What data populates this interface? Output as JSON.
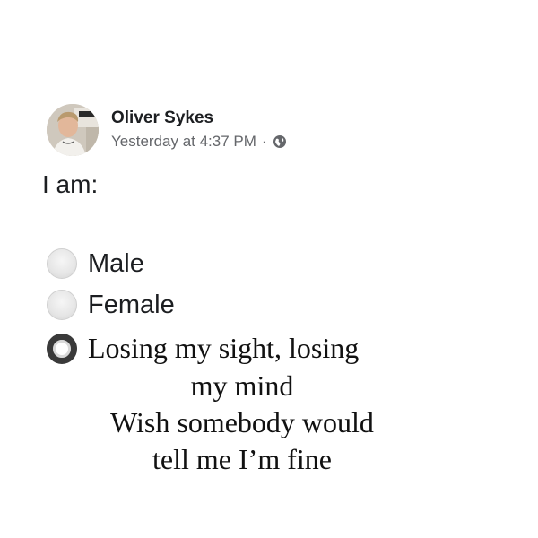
{
  "post": {
    "author": "Oliver Sykes",
    "timestamp": "Yesterday at 4:37 PM",
    "separator": "·",
    "privacy_icon": "globe-icon",
    "question": "I am:",
    "options": [
      {
        "label": "Male",
        "selected": false
      },
      {
        "label": "Female",
        "selected": false
      },
      {
        "label": "Losing my sight, losing",
        "selected": true
      }
    ],
    "lyric_lines": [
      "my mind",
      "Wish somebody would",
      "tell me I’m fine"
    ]
  },
  "colors": {
    "text": "#1c1e21",
    "meta": "#65676b",
    "radio_selected_border": "#3a3a3a"
  }
}
